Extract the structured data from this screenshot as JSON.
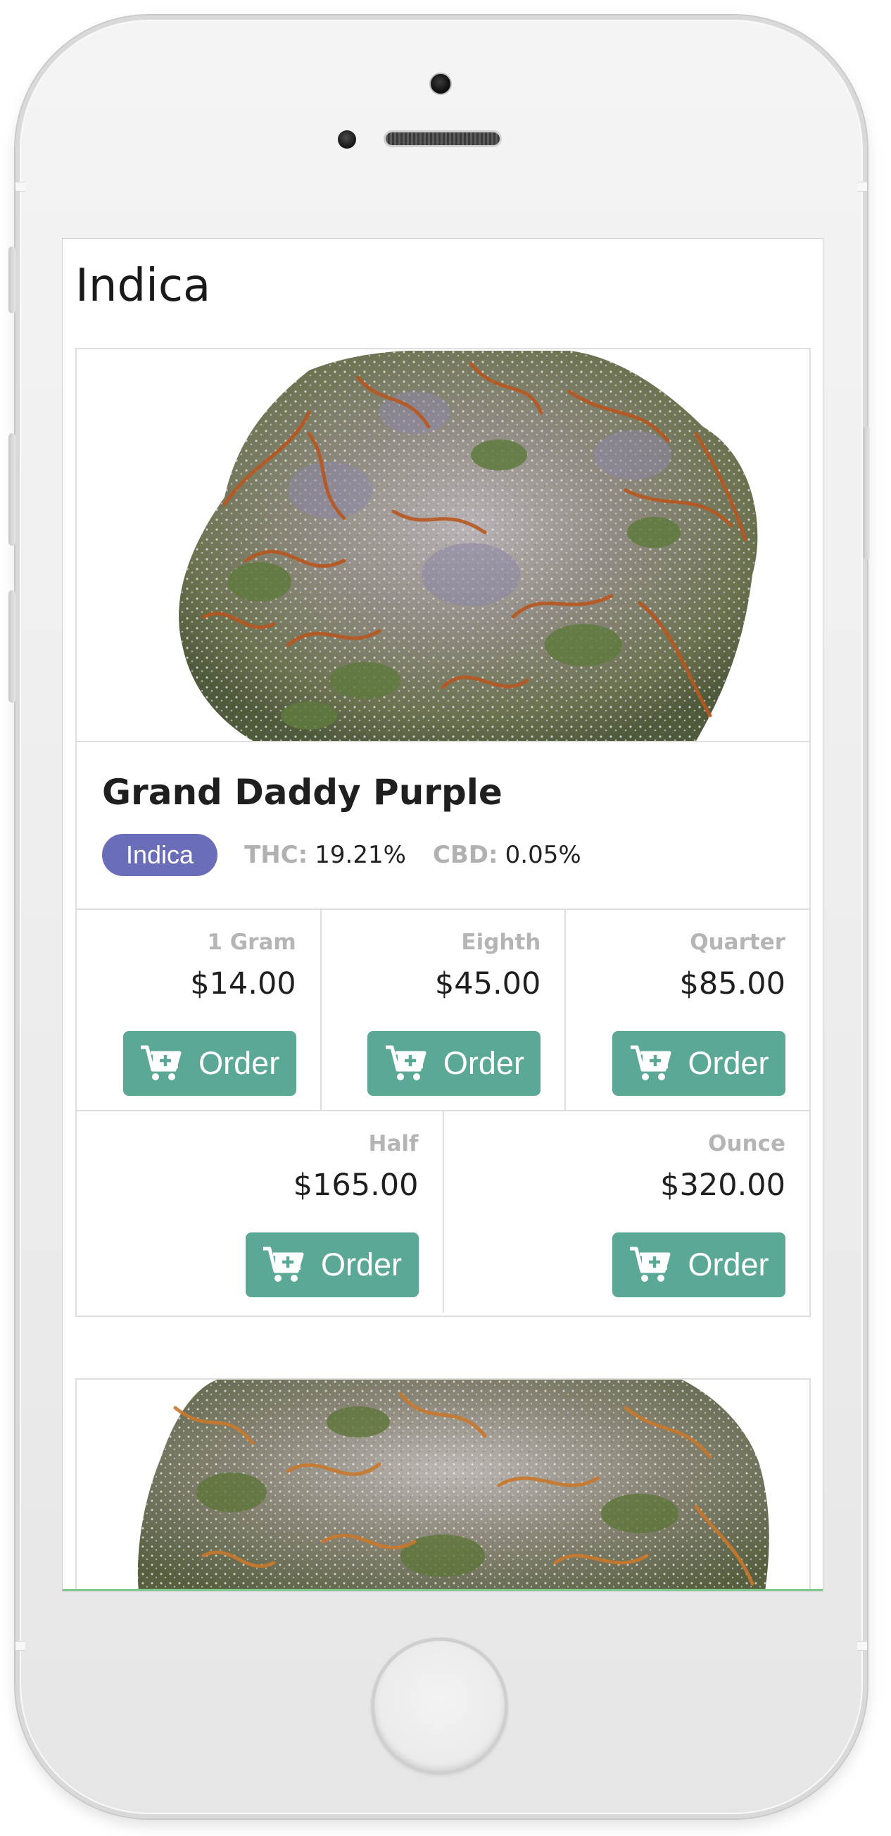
{
  "page": {
    "section_title": "Indica"
  },
  "products": [
    {
      "name": "Grand Daddy Purple",
      "strain_badge": "Indica",
      "thc_label": "THC:",
      "thc_value": "19.21%",
      "cbd_label": "CBD:",
      "cbd_value": "0.05%",
      "prices": [
        {
          "weight": "1 Gram",
          "price": "$14.00",
          "button": "Order"
        },
        {
          "weight": "Eighth",
          "price": "$45.00",
          "button": "Order"
        },
        {
          "weight": "Quarter",
          "price": "$85.00",
          "button": "Order"
        },
        {
          "weight": "Half",
          "price": "$165.00",
          "button": "Order"
        },
        {
          "weight": "Ounce",
          "price": "$320.00",
          "button": "Order"
        }
      ]
    }
  ],
  "icons": {
    "order": "add-to-cart-icon"
  },
  "colors": {
    "badge_indica": "#6a6db7",
    "order_button": "#5ca897",
    "label_gray": "#b5b5b5"
  }
}
